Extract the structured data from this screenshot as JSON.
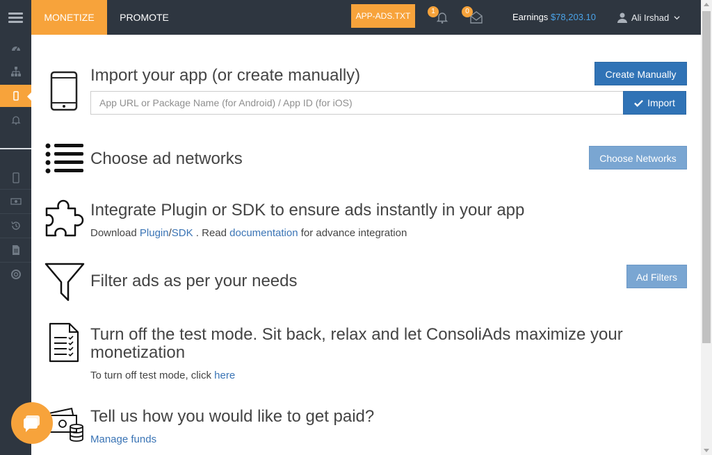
{
  "topbar": {
    "tabs": [
      {
        "label": "MONETIZE",
        "active": true
      },
      {
        "label": "PROMOTE",
        "active": false
      }
    ],
    "app_ads_label": "APP-ADS.TXT",
    "notifications_count": "1",
    "messages_count": "0",
    "earnings_label": "Earnings",
    "earnings_amount": "$78,203.10",
    "user_name": "Ali Irshad"
  },
  "steps": {
    "import": {
      "heading": "Import your app (or create manually)",
      "input_placeholder": "App URL or Package Name (for Android) / App ID (for iOS)",
      "import_button": "Import",
      "create_button": "Create Manually"
    },
    "networks": {
      "heading": "Choose ad networks",
      "button": "Choose Networks"
    },
    "integrate": {
      "heading": "Integrate Plugin or SDK to ensure ads instantly in your app",
      "text_download": "Download ",
      "link_plugin": "Plugin",
      "text_slash": "/",
      "link_sdk": "SDK",
      "text_read": " . Read ",
      "link_documentation": "documentation",
      "text_tail": " for advance integration"
    },
    "filters": {
      "heading": "Filter ads as per your needs",
      "button": "Ad Filters"
    },
    "testmode": {
      "heading": "Turn off the test mode. Sit back, relax and let ConsoliAds maximize your monetization",
      "text": "To turn off test mode, click ",
      "link_here": "here"
    },
    "payment": {
      "heading": "Tell us how you would like to get paid?",
      "link_manage": "Manage funds"
    }
  },
  "colors": {
    "accent": "#f7a33b",
    "dark_bg": "#2e3640",
    "primary_button": "#3073b6",
    "light_button": "#7aa6d2",
    "earnings": "#4aa3e8"
  }
}
